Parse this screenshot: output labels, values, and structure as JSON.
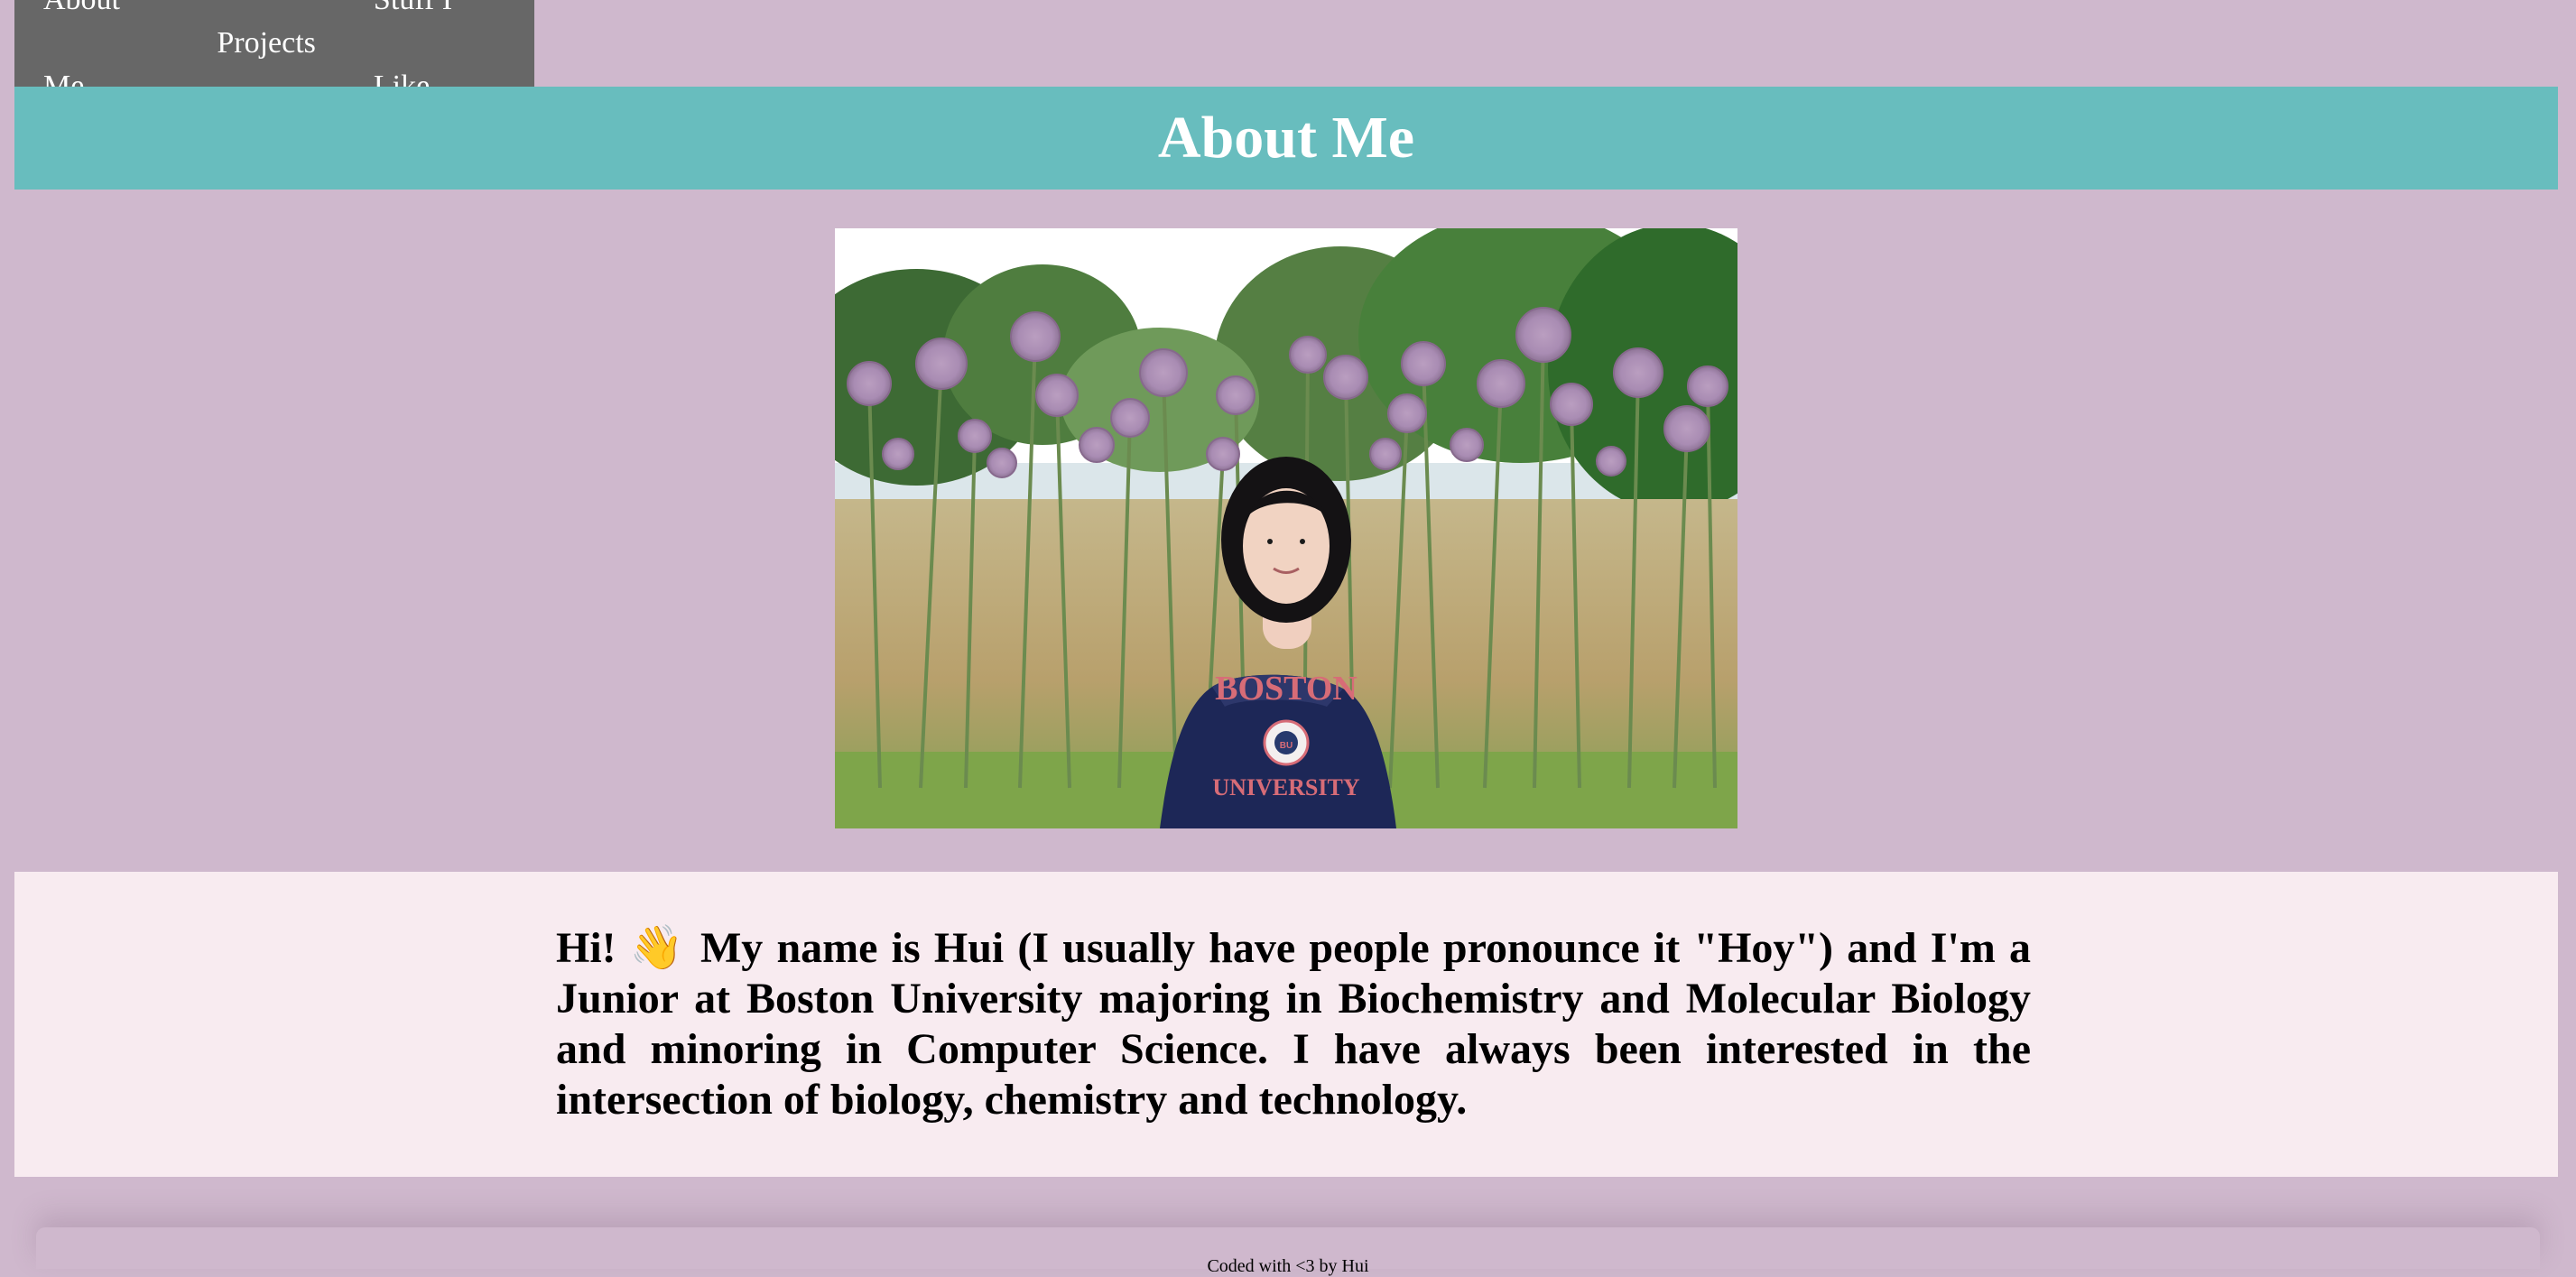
{
  "nav": {
    "items": [
      {
        "label": "About Me"
      },
      {
        "label": "Projects"
      },
      {
        "label": "Stuff I Like"
      }
    ]
  },
  "header": {
    "title": "About Me"
  },
  "bio": {
    "text": "Hi! 👋 My name is Hui (I usually have people pronounce it \"Hoy\") and I'm a Junior at Boston University majoring in Biochemistry and Molecular Biology and minoring in Computer Science. I have always been interested in the intersection of biology, chemistry and technology."
  },
  "photo": {
    "sweatshirt_line1": "BOSTON",
    "sweatshirt_line2": "UNIVERSITY",
    "seal_text": "BU"
  },
  "footer": {
    "text": "Coded with <3 by Hui"
  },
  "colors": {
    "page_background": "#cfb8cd",
    "nav_background": "#676767",
    "header_background": "#68bdbe",
    "bio_background": "#f8ebf0"
  }
}
